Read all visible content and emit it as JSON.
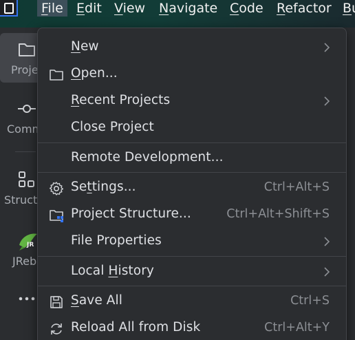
{
  "menubar": {
    "items": [
      {
        "label": "File",
        "mnemonic": "F"
      },
      {
        "label": "Edit",
        "mnemonic": "E"
      },
      {
        "label": "View",
        "mnemonic": "V"
      },
      {
        "label": "Navigate",
        "mnemonic": "N"
      },
      {
        "label": "Code",
        "mnemonic": "C"
      },
      {
        "label": "Refactor",
        "mnemonic": "R"
      },
      {
        "label": "Bu",
        "mnemonic": "B"
      }
    ]
  },
  "toolstrip": {
    "items": [
      {
        "label": "Proje",
        "icon": "folder-icon"
      },
      {
        "label": "Comm",
        "icon": "commit-icon"
      },
      {
        "label": "Struct",
        "icon": "structure-icon"
      },
      {
        "label": "JRebe",
        "icon": "jrebel-icon"
      },
      {
        "label": "",
        "icon": "more-icon"
      }
    ]
  },
  "file_menu": {
    "new": {
      "label": "New",
      "mnemonic": "N",
      "rest": "ew"
    },
    "open": {
      "pre": "",
      "mnemonic": "O",
      "rest": "pen..."
    },
    "recent": {
      "pre": "",
      "mnemonic": "R",
      "rest": "ecent Projects"
    },
    "close": {
      "label": "Close Project"
    },
    "remote": {
      "label": "Remote Development..."
    },
    "settings": {
      "pre": "Se",
      "mnemonic": "t",
      "rest": "tings...",
      "shortcut": "Ctrl+Alt+S"
    },
    "structure": {
      "label": "Project Structure...",
      "shortcut": "Ctrl+Alt+Shift+S"
    },
    "properties": {
      "label": "File Properties"
    },
    "history": {
      "pre": "Local ",
      "mnemonic": "H",
      "rest": "istory"
    },
    "save_all": {
      "pre": "",
      "mnemonic": "S",
      "rest": "ave All",
      "shortcut": "Ctrl+S"
    },
    "reload": {
      "label": "Reload All from Disk",
      "shortcut": "Ctrl+Alt+Y"
    }
  },
  "colors": {
    "menubar_bg": "#123c37",
    "popup_bg": "#2b2d30",
    "separator": "#43454a",
    "accent": "#3574f0",
    "jrebel_green": "#62b543"
  }
}
